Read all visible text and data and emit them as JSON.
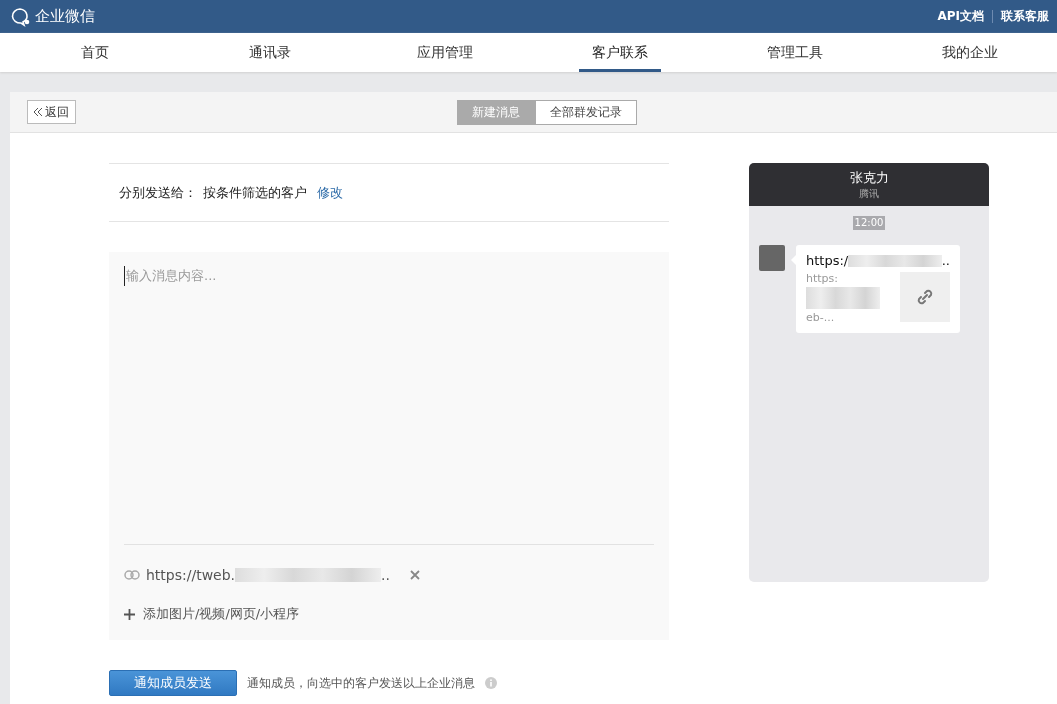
{
  "header": {
    "logo": "企业微信",
    "links": [
      {
        "label": "API文档"
      },
      {
        "label": "联系客服"
      }
    ]
  },
  "nav": [
    {
      "label": "首页",
      "selected": false
    },
    {
      "label": "通讯录",
      "selected": false
    },
    {
      "label": "应用管理",
      "selected": false
    },
    {
      "label": "客户联系",
      "selected": true
    },
    {
      "label": "管理工具",
      "selected": false
    },
    {
      "label": "我的企业",
      "selected": false
    }
  ],
  "toolbar": {
    "back": "返回",
    "tabs": [
      {
        "label": "新建消息",
        "selected": true
      },
      {
        "label": "全部群发记录",
        "selected": false
      }
    ]
  },
  "recipients": {
    "label": "分别发送给：",
    "value": "按条件筛选的客户",
    "edit": "修改"
  },
  "editor": {
    "placeholder": "输入消息内容...",
    "attachment_url": "https://tweb.",
    "attachment_ellipsis": "..",
    "add": "添加图片/视频/网页/小程序"
  },
  "send": {
    "button": "通知成员发送",
    "hint": "通知成员，向选中的客户发送以上企业消息"
  },
  "preview": {
    "name": "张克力",
    "company": "腾讯",
    "time": "12:00",
    "card_title": "https:/",
    "card_title_end": "..",
    "card_desc_start": "https:",
    "card_desc_end": "eb-..."
  }
}
